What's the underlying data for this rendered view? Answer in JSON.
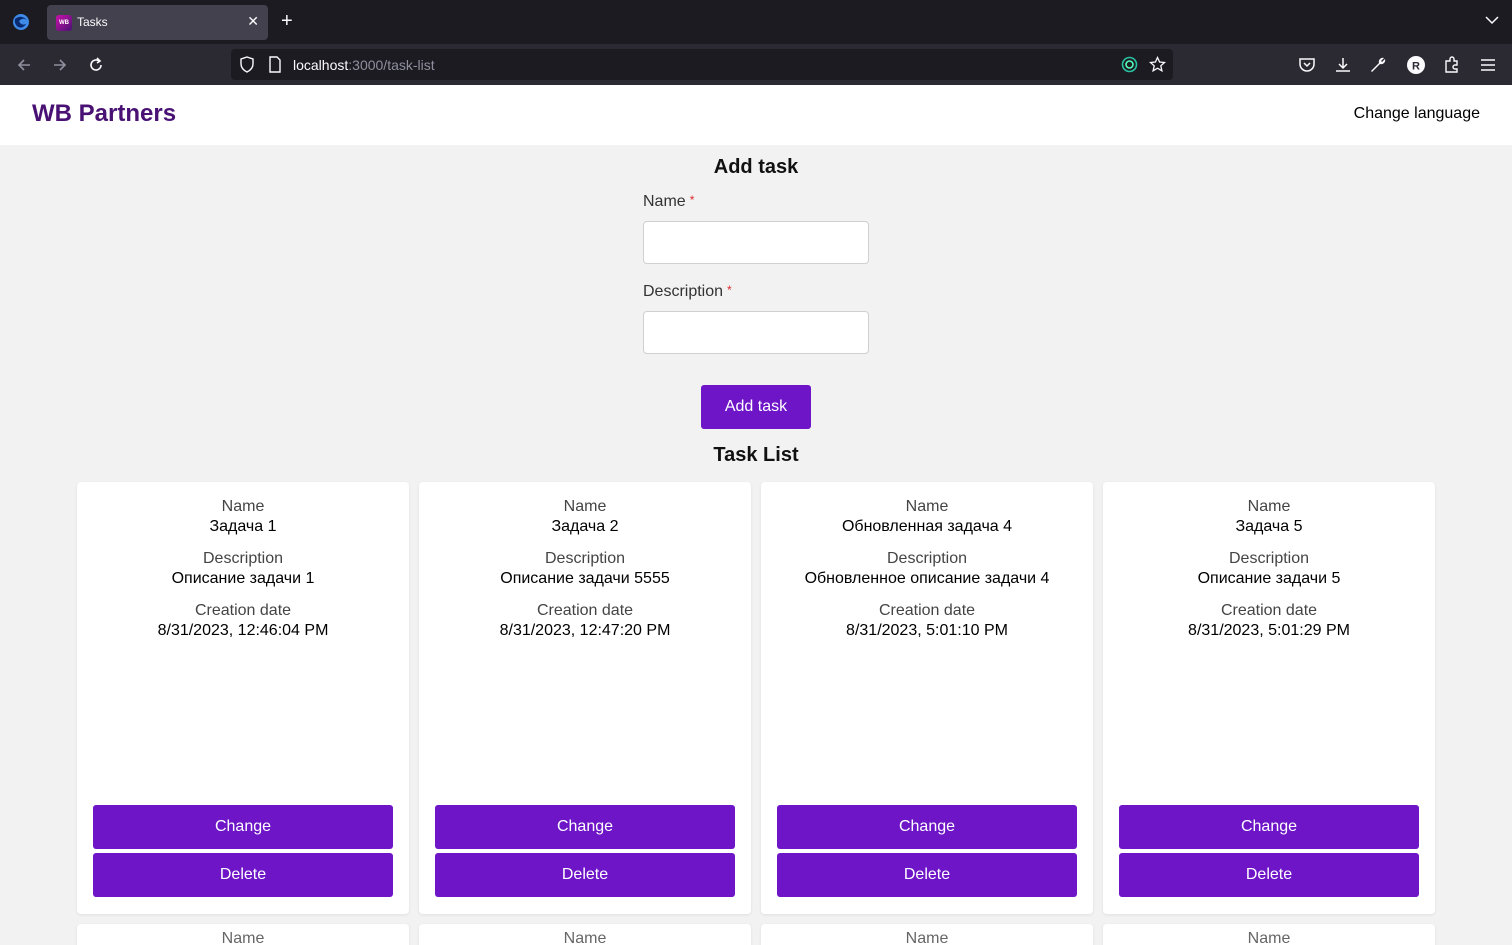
{
  "browser": {
    "tab_title": "Tasks",
    "tab_favicon": "WB",
    "url_host": "localhost",
    "url_path": ":3000/task-list"
  },
  "app": {
    "logo": "WB Partners",
    "change_language": "Change language"
  },
  "form": {
    "title": "Add task",
    "name_label": "Name",
    "description_label": "Description",
    "required_mark": "*",
    "name_value": "",
    "description_value": "",
    "submit_label": "Add task"
  },
  "list": {
    "title": "Task List",
    "name_label": "Name",
    "description_label": "Description",
    "date_label": "Creation date",
    "change_label": "Change",
    "delete_label": "Delete",
    "tasks": [
      {
        "name": "Задача 1",
        "description": "Описание задачи 1",
        "date": "8/31/2023, 12:46:04 PM"
      },
      {
        "name": "Задача 2",
        "description": "Описание задачи 5555",
        "date": "8/31/2023, 12:47:20 PM"
      },
      {
        "name": "Обновленная задача 4",
        "description": "Обновленное описание задачи 4",
        "date": "8/31/2023, 5:01:10 PM"
      },
      {
        "name": "Задача 5",
        "description": "Описание задачи 5",
        "date": "8/31/2023, 5:01:29 PM"
      }
    ],
    "next_row_label": "Name"
  },
  "colors": {
    "brand": "#481173",
    "button": "#6e15c8",
    "required": "#e0282b",
    "page_bg": "#f2f2f2"
  }
}
